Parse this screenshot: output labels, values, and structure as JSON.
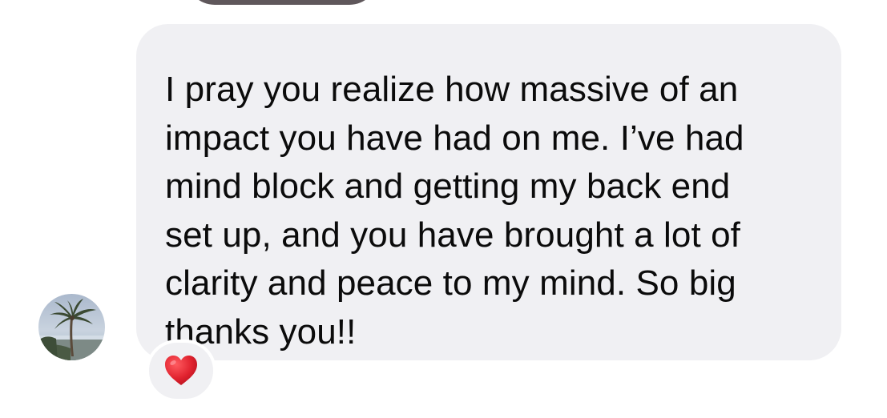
{
  "message": {
    "text": "I pray you realize how massive of an\nimpact you have had on me. I’ve had\nmind block and getting my back end\nset up, and you have brought a lot of\nclarity and peace to my mind. So big\nthanks you!!"
  },
  "avatar": {
    "icon": "palm-tree-photo"
  },
  "reaction": {
    "icon": "red-heart-icon",
    "color": "#e0222e"
  },
  "colors": {
    "bubble": "#f0f0f3",
    "text": "#0b0b0b",
    "previous_bubble": "#5f575b"
  }
}
